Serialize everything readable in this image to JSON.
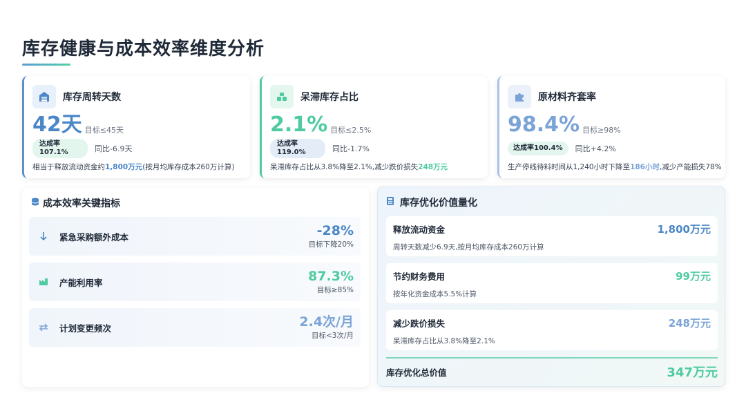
{
  "title": "库存健康与成本效率维度分析",
  "kpis": [
    {
      "title": "库存周转天数",
      "icon": "warehouse-icon",
      "value": "42天",
      "target": "目标≤45天",
      "rate_label": "达成率",
      "rate_value": "107.1%",
      "yoy": "同比-6.9天",
      "note_prefix": "相当于释放流动资金约",
      "note_highlight": "1,800万元",
      "note_suffix": "(按月均库存成本260万计算)"
    },
    {
      "title": "呆滞库存占比",
      "icon": "boxes-icon",
      "value": "2.1%",
      "target": "目标≤2.5%",
      "rate_label": "达成率",
      "rate_value": "119.0%",
      "yoy": "同比-1.7%",
      "note_prefix": "呆滞库存占比从3.8%降至2.1%,减少跌价损失",
      "note_highlight": "248万元",
      "note_suffix": ""
    },
    {
      "title": "原材料齐套率",
      "icon": "puzzle-icon",
      "value": "98.4%",
      "target": "目标≥98%",
      "rate_label": "达成率100.4%",
      "yoy": "同比+4.2%",
      "note_prefix": "生产停线待料时间从1,240小时下降至",
      "note_highlight": "186小时",
      "note_suffix": ",减少产能损失78%"
    }
  ],
  "cost_panel": {
    "title": "成本效率关键指标",
    "metrics": [
      {
        "label": "紧急采购额外成本",
        "value": "-28%",
        "target": "目标下降20%",
        "icon": "arrow-down-icon"
      },
      {
        "label": "产能利用率",
        "value": "87.3%",
        "target": "目标≥85%",
        "icon": "factory-icon"
      },
      {
        "label": "计划变更频次",
        "value": "2.4次/月",
        "target": "目标<3次/月",
        "icon": "exchange-icon"
      }
    ]
  },
  "value_panel": {
    "title": "库存优化价值量化",
    "items": [
      {
        "label": "释放流动资金",
        "value": "1,800万元",
        "sub": "周转天数减少6.9天,按月均库存成本260万计算"
      },
      {
        "label": "节约财务费用",
        "value": "99万元",
        "sub": "按年化资金成本5.5%计算"
      },
      {
        "label": "减少跌价损失",
        "value": "248万元",
        "sub": "呆滞库存占比从3.8%降至2.1%"
      }
    ],
    "total_label": "库存优化总价值",
    "total_value": "347万元"
  },
  "colors": {
    "blue": "#4a86c8",
    "green": "#4ecb9f",
    "light_blue": "#7aa3d6"
  }
}
